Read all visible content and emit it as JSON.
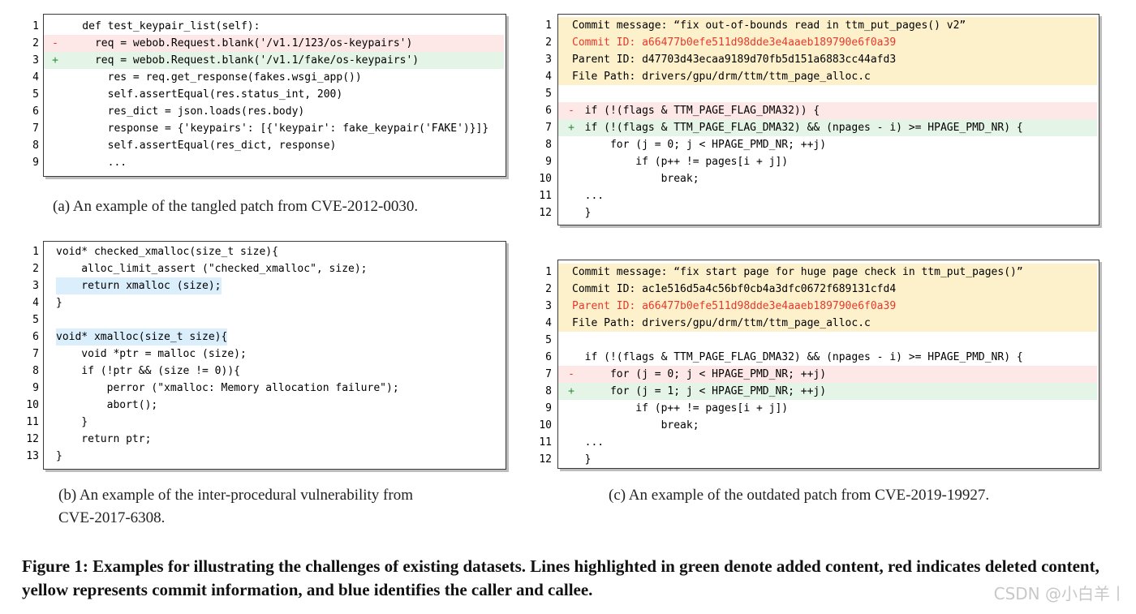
{
  "panel_a": {
    "lines": [
      {
        "n": "1",
        "m": "",
        "c": "    def test_keypair_list(self):",
        "t": ""
      },
      {
        "n": "2",
        "m": "-",
        "c": "      req = webob.Request.blank('/v1.1/123/os-keypairs')",
        "t": "del"
      },
      {
        "n": "3",
        "m": "+",
        "c": "      req = webob.Request.blank('/v1.1/fake/os-keypairs')",
        "t": "add"
      },
      {
        "n": "4",
        "m": "",
        "c": "        res = req.get_response(fakes.wsgi_app())",
        "t": ""
      },
      {
        "n": "5",
        "m": "",
        "c": "        self.assertEqual(res.status_int, 200)",
        "t": ""
      },
      {
        "n": "6",
        "m": "",
        "c": "        res_dict = json.loads(res.body)",
        "t": ""
      },
      {
        "n": "7",
        "m": "",
        "c": "        response = {'keypairs': [{'keypair': fake_keypair('FAKE')}]}",
        "t": ""
      },
      {
        "n": "8",
        "m": "",
        "c": "        self.assertEqual(res_dict, response)",
        "t": ""
      },
      {
        "n": "9",
        "m": "",
        "c": "        ...",
        "t": ""
      }
    ],
    "caption": "(a) An example of the tangled patch from CVE-2012-0030."
  },
  "panel_b": {
    "lines": [
      {
        "n": "1",
        "m": "",
        "c": "void* checked_xmalloc(size_t size){",
        "t": ""
      },
      {
        "n": "2",
        "m": "",
        "c": "    alloc_limit_assert (\"checked_xmalloc\", size);",
        "t": ""
      },
      {
        "n": "3",
        "m": "",
        "c": "    return xmalloc (size);",
        "t": "call"
      },
      {
        "n": "4",
        "m": "",
        "c": "}",
        "t": ""
      },
      {
        "n": "5",
        "m": "",
        "c": "",
        "t": ""
      },
      {
        "n": "6",
        "m": "",
        "c": "void* xmalloc(size_t size){",
        "t": "call"
      },
      {
        "n": "7",
        "m": "",
        "c": "    void *ptr = malloc (size);",
        "t": ""
      },
      {
        "n": "8",
        "m": "",
        "c": "    if (!ptr && (size != 0)){",
        "t": ""
      },
      {
        "n": "9",
        "m": "",
        "c": "        perror (\"xmalloc: Memory allocation failure\");",
        "t": ""
      },
      {
        "n": "10",
        "m": "",
        "c": "        abort();",
        "t": ""
      },
      {
        "n": "11",
        "m": "",
        "c": "    }",
        "t": ""
      },
      {
        "n": "12",
        "m": "",
        "c": "    return ptr;",
        "t": ""
      },
      {
        "n": "13",
        "m": "",
        "c": "}",
        "t": ""
      }
    ],
    "caption_line1": "(b) An example of the inter-procedural vulnerability from",
    "caption_line2": "CVE-2017-6308."
  },
  "panel_c1": {
    "lines": [
      {
        "n": "1",
        "m": "",
        "c": "Commit message: “fix out-of-bounds read in ttm_put_pages() v2”",
        "t": "info"
      },
      {
        "n": "2",
        "m": "",
        "c": "Commit ID: a66477b0efe511d98dde3e4aaeb189790e6f0a39",
        "t": "info red"
      },
      {
        "n": "3",
        "m": "",
        "c": "Parent ID: d47703d43ecaa9189d70fb5d151a6883cc44afd3",
        "t": "info"
      },
      {
        "n": "4",
        "m": "",
        "c": "File Path: drivers/gpu/drm/ttm/ttm_page_alloc.c",
        "t": "info"
      },
      {
        "n": "5",
        "m": "",
        "c": "",
        "t": ""
      },
      {
        "n": "6",
        "m": "-",
        "c": "  if (!(flags & TTM_PAGE_FLAG_DMA32)) {",
        "t": "del"
      },
      {
        "n": "7",
        "m": "+",
        "c": "  if (!(flags & TTM_PAGE_FLAG_DMA32) && (npages - i) >= HPAGE_PMD_NR) {",
        "t": "add"
      },
      {
        "n": "8",
        "m": "",
        "c": "      for (j = 0; j < HPAGE_PMD_NR; ++j)",
        "t": ""
      },
      {
        "n": "9",
        "m": "",
        "c": "          if (p++ != pages[i + j])",
        "t": ""
      },
      {
        "n": "10",
        "m": "",
        "c": "              break;",
        "t": ""
      },
      {
        "n": "11",
        "m": "",
        "c": "  ...",
        "t": ""
      },
      {
        "n": "12",
        "m": "",
        "c": "  }",
        "t": ""
      }
    ]
  },
  "panel_c2": {
    "lines": [
      {
        "n": "1",
        "m": "",
        "c": "Commit message: “fix start page for huge page check in ttm_put_pages()”",
        "t": "info"
      },
      {
        "n": "2",
        "m": "",
        "c": "Commit ID: ac1e516d5a4c56bf0cb4a3dfc0672f689131cfd4",
        "t": "info"
      },
      {
        "n": "3",
        "m": "",
        "c": "Parent ID: a66477b0efe511d98dde3e4aaeb189790e6f0a39",
        "t": "info red"
      },
      {
        "n": "4",
        "m": "",
        "c": "File Path: drivers/gpu/drm/ttm/ttm_page_alloc.c",
        "t": "info"
      },
      {
        "n": "5",
        "m": "",
        "c": "",
        "t": ""
      },
      {
        "n": "6",
        "m": "",
        "c": "  if (!(flags & TTM_PAGE_FLAG_DMA32) && (npages - i) >= HPAGE_PMD_NR) {",
        "t": ""
      },
      {
        "n": "7",
        "m": "-",
        "c": "      for (j = 0; j < HPAGE_PMD_NR; ++j)",
        "t": "del"
      },
      {
        "n": "8",
        "m": "+",
        "c": "      for (j = 1; j < HPAGE_PMD_NR; ++j)",
        "t": "add"
      },
      {
        "n": "9",
        "m": "",
        "c": "          if (p++ != pages[i + j])",
        "t": ""
      },
      {
        "n": "10",
        "m": "",
        "c": "              break;",
        "t": ""
      },
      {
        "n": "11",
        "m": "",
        "c": "  ...",
        "t": ""
      },
      {
        "n": "12",
        "m": "",
        "c": "  }",
        "t": ""
      }
    ],
    "caption": "(c) An example of the outdated patch from CVE-2019-19927."
  },
  "figure": {
    "caption": "Figure 1: Examples for illustrating the challenges of existing datasets. Lines highlighted in green denote added content, red indicates deleted content, yellow represents commit information, and blue identifies the caller and callee."
  },
  "watermark": "CSDN @小白羊丨",
  "colors": {
    "added": "#e4f4e6",
    "deleted": "#fde7e7",
    "commit_info": "#fdf1cc",
    "caller_callee": "#dbeefc",
    "commit_id_red": "#e8382c"
  }
}
